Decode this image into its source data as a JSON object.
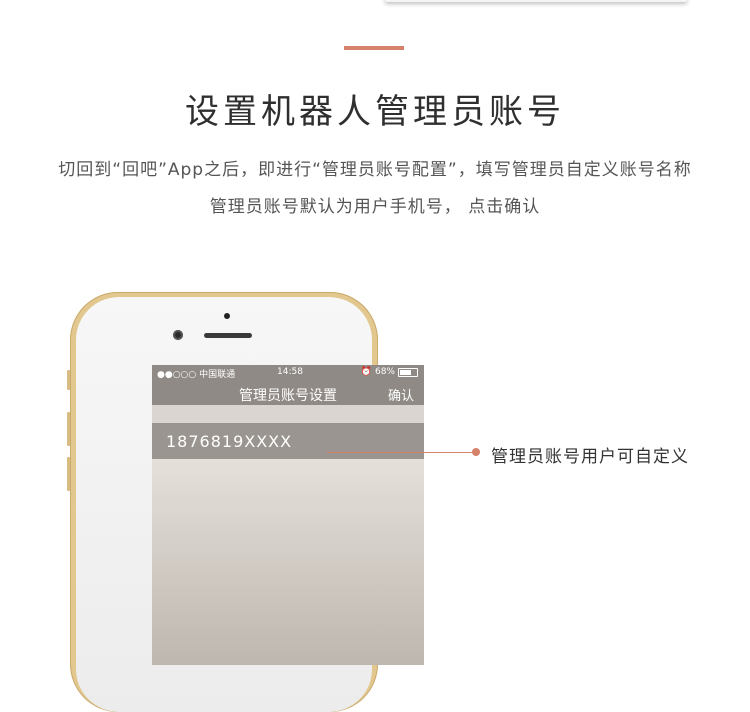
{
  "heading": {
    "title": "设置机器人管理员账号",
    "line1": "切回到“回吧”App之后，即进行“管理员账号配置”，填写管理员自定义账号名称",
    "line2": "管理员账号默认为用户手机号，  点击确认"
  },
  "phone_screen": {
    "status_bar": {
      "carrier": "●●○○○ 中国联通",
      "time": "14:58",
      "battery": "68%"
    },
    "nav": {
      "title": "管理员账号设置",
      "confirm_label": "确认"
    },
    "account_input": {
      "value": "1876819XXXX"
    }
  },
  "callout": {
    "text": "管理员账号用户可自定义"
  },
  "colors": {
    "accent": "#d5826a",
    "phone_gold": "#e2c78f",
    "nav_bg": "#8f8a85"
  }
}
